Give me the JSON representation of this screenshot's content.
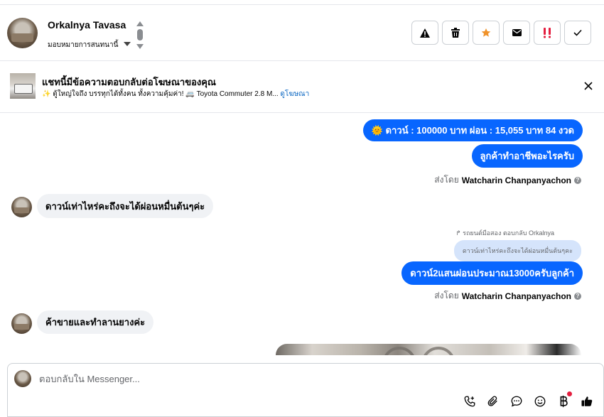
{
  "header": {
    "contact_name": "Orkalnya Tavasa",
    "assign_label": "มอบหมายการสนทนานี้",
    "actions": [
      {
        "name": "report-spam-button",
        "icon": "warning-icon"
      },
      {
        "name": "delete-button",
        "icon": "trash-icon"
      },
      {
        "name": "star-button",
        "icon": "star-icon"
      },
      {
        "name": "mark-unread-button",
        "icon": "envelope-icon"
      },
      {
        "name": "mark-important-button",
        "icon": "double-exclamation-icon"
      },
      {
        "name": "mark-done-button",
        "icon": "check-icon"
      }
    ],
    "colors": {
      "star": "#f0932b",
      "important": "#e41e3f"
    }
  },
  "ad_banner": {
    "title": "แชทนี้มีข้อความตอบกลับต่อโฆษณาของคุณ",
    "subtitle": "✨ ตู้ใหญ่ใจถึง บรรทุกได้ทั้งคน ทั้งความคุ้มค่า! 🚐 Toyota Commuter 2.8 M...",
    "link_label": "ดูโฆษณา"
  },
  "messages": {
    "out_1": "🌞 ดาวน์ : 100000 บาท ผ่อน : 15,055 บาท 84 งวด",
    "out_2": "ลูกค้าทำอาชีพอะไรครับ",
    "sent_by_prefix": "ส่งโดย",
    "sent_by_name": "Watcharin Chanpanyachon",
    "in_1": "ดาวน์เท่าไหร่คะถึงจะได้ผ่อนหมื่นต้นๆค่ะ",
    "reply_meta": "↱ รถยนต์มือสอง ตอบกลับ Orkalnya",
    "quoted": "ดาวน์เท่าไหร่คะถึงจะได้ผ่อนหมื่นต้นๆคะ",
    "out_3": "ดาวน์2แสนผ่อนประมาณ13000ครับลูกค้า",
    "in_2": "ค้าขายและทำลานยางค่ะ"
  },
  "composer": {
    "placeholder": "ตอบกลับใน Messenger...",
    "tools": [
      "call-add-icon",
      "paperclip-icon",
      "chat-bubble-icon",
      "emoji-icon",
      "baht-icon",
      "thumbs-up-icon"
    ],
    "accent": "#0866ff"
  }
}
